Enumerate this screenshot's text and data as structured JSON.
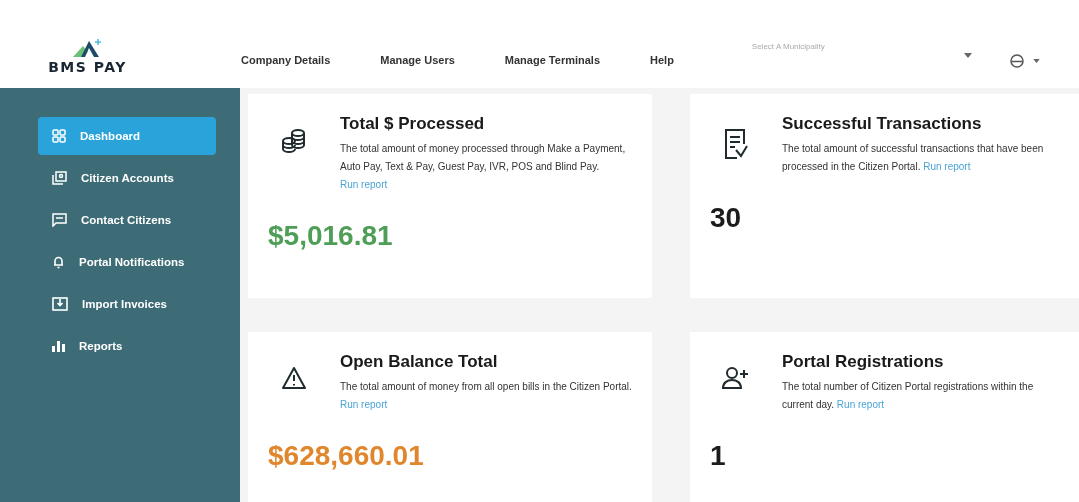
{
  "header": {
    "logo": "BMS PAY",
    "nav": [
      {
        "label": "Company Details"
      },
      {
        "label": "Manage Users"
      },
      {
        "label": "Manage Terminals"
      },
      {
        "label": "Help"
      }
    ],
    "municipality_select": {
      "placeholder": "Select A Municipality"
    }
  },
  "sidebar": {
    "items": [
      {
        "label": "Dashboard",
        "selected": true
      },
      {
        "label": "Citizen Accounts",
        "selected": false
      },
      {
        "label": "Contact Citizens",
        "selected": false
      },
      {
        "label": "Portal Notifications",
        "selected": false
      },
      {
        "label": "Import Invoices",
        "selected": false
      },
      {
        "label": "Reports",
        "selected": false
      }
    ]
  },
  "cards": [
    {
      "title": "Total $ Processed",
      "description": "The total amount of money processed through Make a Payment, Auto Pay, Text & Pay, Guest Pay, IVR, POS and Blind Pay.",
      "link": "Run report",
      "value": "$5,016.81",
      "color": "#4f9e57"
    },
    {
      "title": "Successful Transactions",
      "description": "The total amount of successful transactions that have been processed in the Citizen Portal.",
      "link": "Run report",
      "value": "30",
      "color": "#1c1c1c"
    },
    {
      "title": "Open Balance Total",
      "description": "The total amount of money from all open bills in the Citizen Portal.",
      "link": "Run report",
      "value": "$628,660.01",
      "color": "#e0862c"
    },
    {
      "title": "Portal Registrations",
      "description": "The total number of Citizen Portal registrations within the current day.",
      "link": "Run report",
      "value": "1",
      "color": "#1c1c1c"
    }
  ]
}
